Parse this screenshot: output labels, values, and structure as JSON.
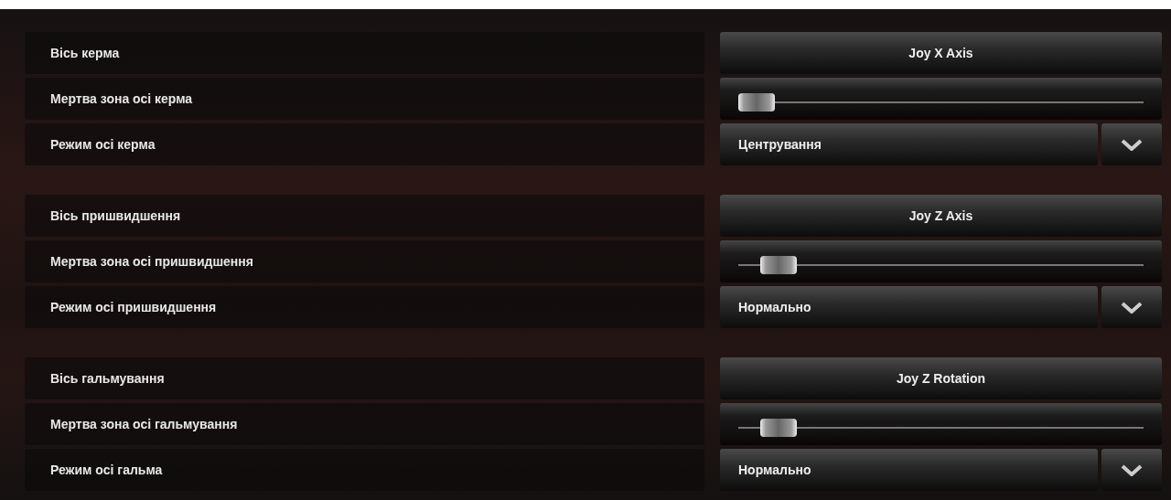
{
  "groups": [
    {
      "rows": [
        {
          "kind": "button",
          "label": "Вісь керма",
          "value": "Joy X Axis"
        },
        {
          "kind": "slider",
          "label": "Мертва зона осі керма",
          "level": 0.0
        },
        {
          "kind": "dropdown",
          "label": "Режим осі керма",
          "value": "Центрування"
        }
      ]
    },
    {
      "rows": [
        {
          "kind": "button",
          "label": "Вісь пришвидшення",
          "value": "Joy Z Axis"
        },
        {
          "kind": "slider",
          "label": "Мертва зона осі пришвидшення",
          "level": 0.1
        },
        {
          "kind": "dropdown",
          "label": "Режим осі пришвидшення",
          "value": "Нормально"
        }
      ]
    },
    {
      "rows": [
        {
          "kind": "button",
          "label": "Вісь гальмування",
          "value": "Joy Z Rotation"
        },
        {
          "kind": "slider",
          "label": "Мертва зона осі гальмування",
          "level": 0.1
        },
        {
          "kind": "dropdown",
          "label": "Режим осі гальма",
          "value": "Нормально"
        }
      ]
    }
  ]
}
